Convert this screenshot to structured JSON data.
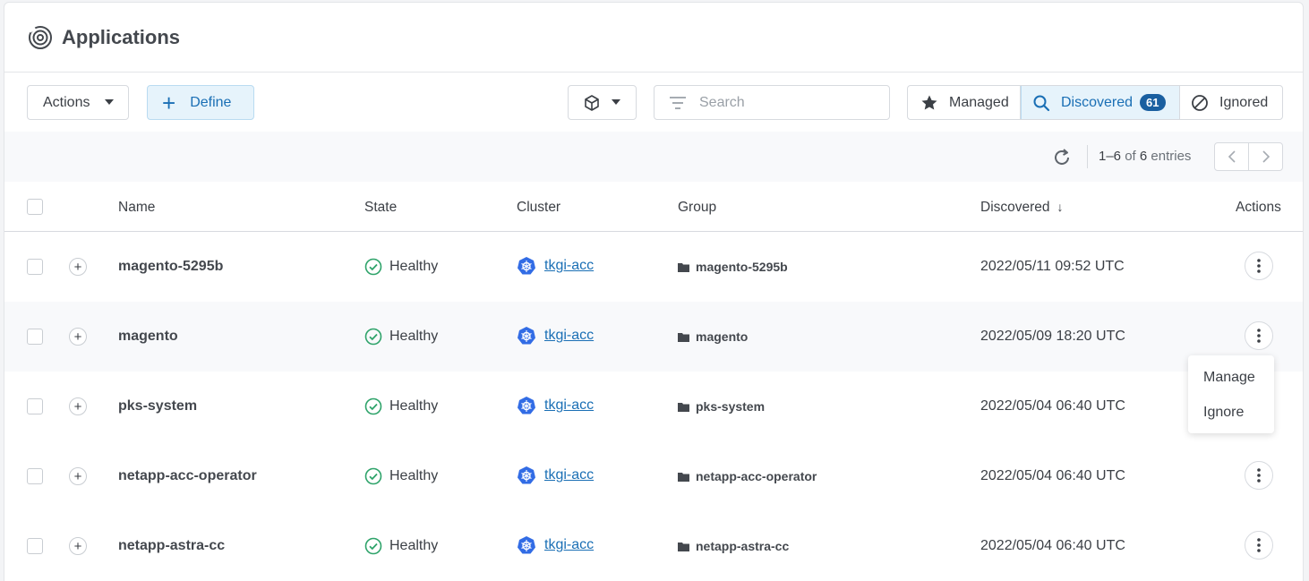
{
  "header": {
    "title": "Applications"
  },
  "toolbar": {
    "actions_label": "Actions",
    "define_label": "Define",
    "search_placeholder": "Search",
    "tabs": [
      {
        "label": "Managed"
      },
      {
        "label": "Discovered",
        "count": "61"
      },
      {
        "label": "Ignored"
      }
    ]
  },
  "pagination": {
    "range": "1–6",
    "of": "of",
    "total": "6",
    "suffix": "entries"
  },
  "table": {
    "columns": {
      "name": "Name",
      "state": "State",
      "cluster": "Cluster",
      "group": "Group",
      "discovered": "Discovered",
      "actions": "Actions"
    },
    "rows": [
      {
        "name": "magento-5295b",
        "state": "Healthy",
        "cluster": "tkgi-acc",
        "group": "magento-5295b",
        "discovered": "2022/05/11 09:52 UTC"
      },
      {
        "name": "magento",
        "state": "Healthy",
        "cluster": "tkgi-acc",
        "group": "magento",
        "discovered": "2022/05/09 18:20 UTC"
      },
      {
        "name": "pks-system",
        "state": "Healthy",
        "cluster": "tkgi-acc",
        "group": "pks-system",
        "discovered": "2022/05/04 06:40 UTC"
      },
      {
        "name": "netapp-acc-operator",
        "state": "Healthy",
        "cluster": "tkgi-acc",
        "group": "netapp-acc-operator",
        "discovered": "2022/05/04 06:40 UTC"
      },
      {
        "name": "netapp-astra-cc",
        "state": "Healthy",
        "cluster": "tkgi-acc",
        "group": "netapp-astra-cc",
        "discovered": "2022/05/04 06:40 UTC"
      }
    ]
  },
  "row_menu": {
    "manage": "Manage",
    "ignore": "Ignore"
  },
  "colors": {
    "accent": "#1a6fb5",
    "success": "#2ea36a",
    "badge": "#1a5fa0"
  }
}
